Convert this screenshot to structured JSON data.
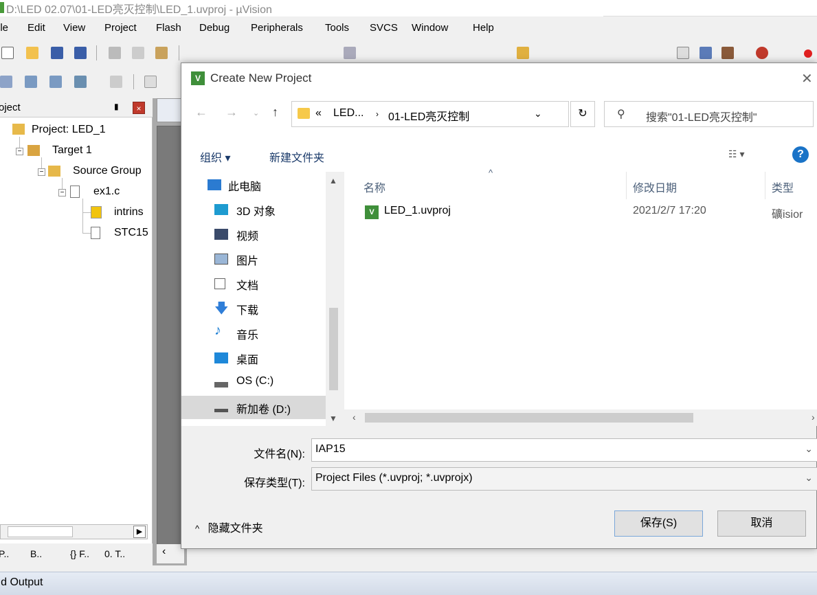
{
  "window": {
    "title": "D:\\LED 02.07\\01-LED亮灭控制\\LED_1.uvproj - µVision"
  },
  "menu": [
    "ile",
    "Edit",
    "View",
    "Project",
    "Flash",
    "Debug",
    "Peripherals",
    "Tools",
    "SVCS",
    "Window",
    "Help"
  ],
  "project_panel": {
    "title": "oject",
    "tree": {
      "project": "Project: LED_1",
      "target": "Target 1",
      "group": "Source Group",
      "file": "ex1.c",
      "child1": "intrins",
      "child2": "STC15"
    },
    "tabs": [
      "P..",
      "B..",
      "{} F..",
      "0. T.."
    ]
  },
  "build_output": {
    "title": "ild Output"
  },
  "dialog": {
    "title": "Create New Project",
    "address": {
      "prefix": "«",
      "crumb1": "LED...",
      "crumb2": "01-LED亮灭控制"
    },
    "search_placeholder": "搜索\"01-LED亮灭控制\"",
    "toolbar": {
      "organize": "组织 ▾",
      "new_folder": "新建文件夹"
    },
    "nav_items": [
      {
        "label": "此电脑",
        "icon": "computer-icon"
      },
      {
        "label": "3D 对象",
        "icon": "3d-objects-icon"
      },
      {
        "label": "视频",
        "icon": "video-icon"
      },
      {
        "label": "图片",
        "icon": "pictures-icon"
      },
      {
        "label": "文档",
        "icon": "documents-icon"
      },
      {
        "label": "下载",
        "icon": "downloads-icon"
      },
      {
        "label": "音乐",
        "icon": "music-icon"
      },
      {
        "label": "桌面",
        "icon": "desktop-icon"
      },
      {
        "label": "OS (C:)",
        "icon": "drive-c-icon"
      },
      {
        "label": "新加卷 (D:)",
        "icon": "drive-d-icon",
        "selected": true
      }
    ],
    "columns": {
      "name": "名称",
      "date": "修改日期",
      "type": "类型"
    },
    "files": [
      {
        "name": "LED_1.uvproj",
        "date": "2021/2/7 17:20",
        "type": "礦isior"
      }
    ],
    "filename_label": "文件名(N):",
    "filename_value": "IAP15",
    "filetype_label": "保存类型(T):",
    "filetype_value": "Project Files (*.uvproj; *.uvprojx)",
    "hide_folders": "隐藏文件夹",
    "save_label": "保存(S)",
    "cancel_label": "取消"
  }
}
